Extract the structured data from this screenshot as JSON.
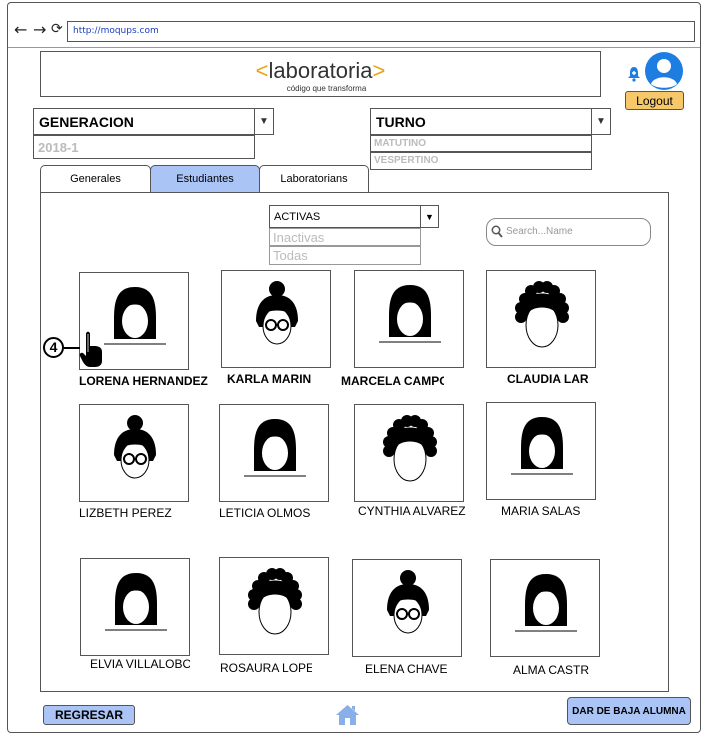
{
  "browser": {
    "url": "http://moqups.com"
  },
  "logo": {
    "text": "laboratoria",
    "bracket_left": "<",
    "bracket_right": ">",
    "tagline": "código que transforma"
  },
  "header": {
    "logout_label": "Logout"
  },
  "generacion": {
    "label": "GENERACION",
    "selected": "2018-1"
  },
  "turno": {
    "label": "TURNO",
    "options": [
      "MATUTINO",
      "VESPERTINO"
    ]
  },
  "tabs": [
    {
      "label": "Generales"
    },
    {
      "label": "Estudiantes"
    },
    {
      "label": "Laboratorians"
    }
  ],
  "status_filter": {
    "selected": "ACTIVAS",
    "options": [
      "Inactivas",
      "Todas"
    ]
  },
  "search": {
    "placeholder": "Search...Name"
  },
  "annotation": {
    "step": "4"
  },
  "students": [
    {
      "name": "LORENA HERNANDEZ",
      "avatar": "straight-hair"
    },
    {
      "name": "KARLA MARIN",
      "avatar": "bun-glasses"
    },
    {
      "name": "MARCELA CAMPO",
      "avatar": "straight-hair"
    },
    {
      "name": "CLAUDIA LAR",
      "avatar": "curly-hair"
    },
    {
      "name": "LIZBETH PEREZ",
      "avatar": "bun-glasses"
    },
    {
      "name": "LETICIA OLMOS",
      "avatar": "straight-hair"
    },
    {
      "name": "CYNTHIA ALVAREZ",
      "avatar": "curly-hair"
    },
    {
      "name": "MARIA SALAS",
      "avatar": "straight-hair"
    },
    {
      "name": "ELVIA VILLALOBO",
      "avatar": "straight-hair"
    },
    {
      "name": "ROSAURA LOPE",
      "avatar": "curly-hair"
    },
    {
      "name": "ELENA CHAVE",
      "avatar": "bun-glasses"
    },
    {
      "name": "ALMA CASTR",
      "avatar": "straight-hair"
    }
  ],
  "footer": {
    "back_label": "REGRESAR",
    "deactivate_label": "DAR DE BAJA ALUMNA"
  },
  "colors": {
    "active_tab": "#a9c4f5",
    "logout": "#f6c86a",
    "brand_bracket": "#e8a317",
    "home_icon": "#8aaee8",
    "avatar_icon": "#1e7de0"
  }
}
